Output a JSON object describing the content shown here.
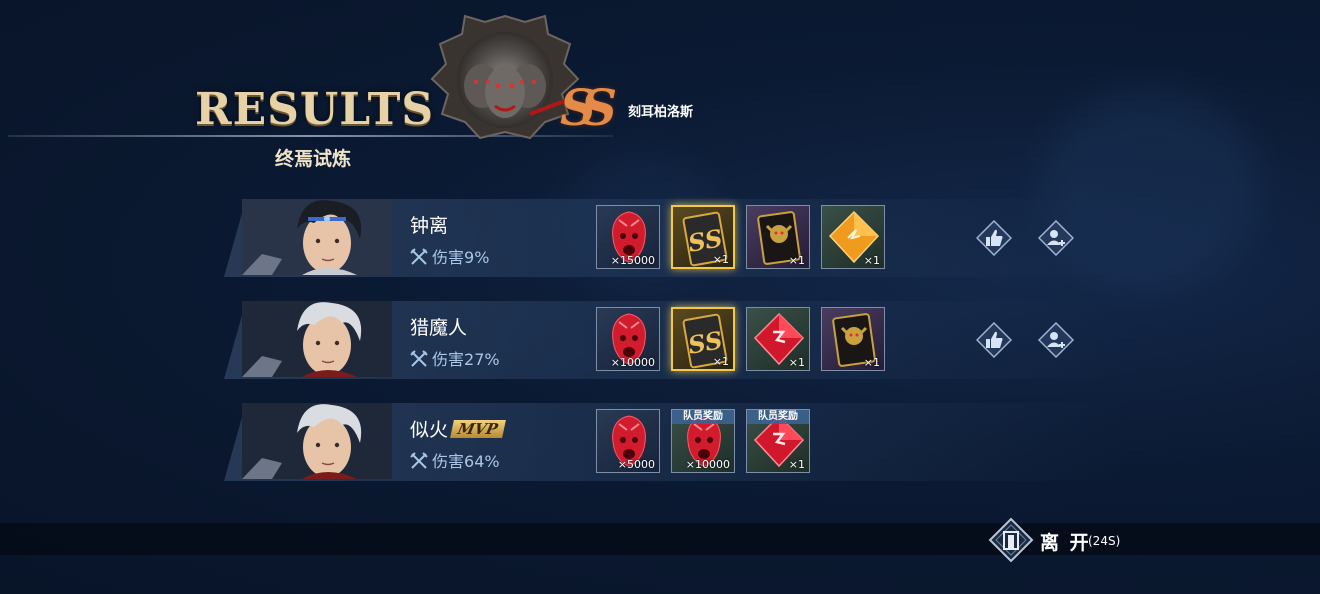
{
  "header": {
    "title_en": "RESULTS",
    "title_cn": "终焉试炼",
    "boss_name": "刻耳柏洛斯",
    "rank": "SS"
  },
  "players": [
    {
      "name": "钟离",
      "damage_label": "伤害",
      "damage_value": "9%",
      "mvp": false,
      "rewards": [
        {
          "icon": "red-mask-icon",
          "qty": "×15000",
          "style": "normal"
        },
        {
          "icon": "ss-card-icon",
          "qty": "×1",
          "style": "gold"
        },
        {
          "icon": "demon-card-icon",
          "qty": "×1",
          "style": "purple"
        },
        {
          "icon": "orange-gem-icon",
          "qty": "×1",
          "style": "green"
        }
      ],
      "actions": [
        "like",
        "add-friend"
      ]
    },
    {
      "name": "猎魔人",
      "damage_label": "伤害",
      "damage_value": "27%",
      "mvp": false,
      "rewards": [
        {
          "icon": "red-mask-icon",
          "qty": "×10000",
          "style": "normal"
        },
        {
          "icon": "ss-card-icon",
          "qty": "×1",
          "style": "gold"
        },
        {
          "icon": "red-gem-icon",
          "qty": "×1",
          "style": "green"
        },
        {
          "icon": "demon-card-icon",
          "qty": "×1",
          "style": "purple"
        }
      ],
      "actions": [
        "like",
        "add-friend"
      ]
    },
    {
      "name": "似火",
      "damage_label": "伤害",
      "damage_value": "64%",
      "mvp": true,
      "mvp_label": "MVP",
      "rewards": [
        {
          "icon": "red-mask-icon",
          "qty": "×5000",
          "style": "normal"
        },
        {
          "icon": "red-mask-icon",
          "qty": "×10000",
          "style": "green",
          "banner": "队员奖励"
        },
        {
          "icon": "red-gem-icon",
          "qty": "×1",
          "style": "green",
          "banner": "队员奖励"
        }
      ],
      "actions": []
    }
  ],
  "footer": {
    "leave_label": "离 开",
    "leave_timer": "(24S)"
  },
  "colors": {
    "background": "#0b1a33",
    "title_gold": "#e6d2a6",
    "rank_orange": "#e58b4a",
    "highlight_gold": "#f2c94c"
  }
}
